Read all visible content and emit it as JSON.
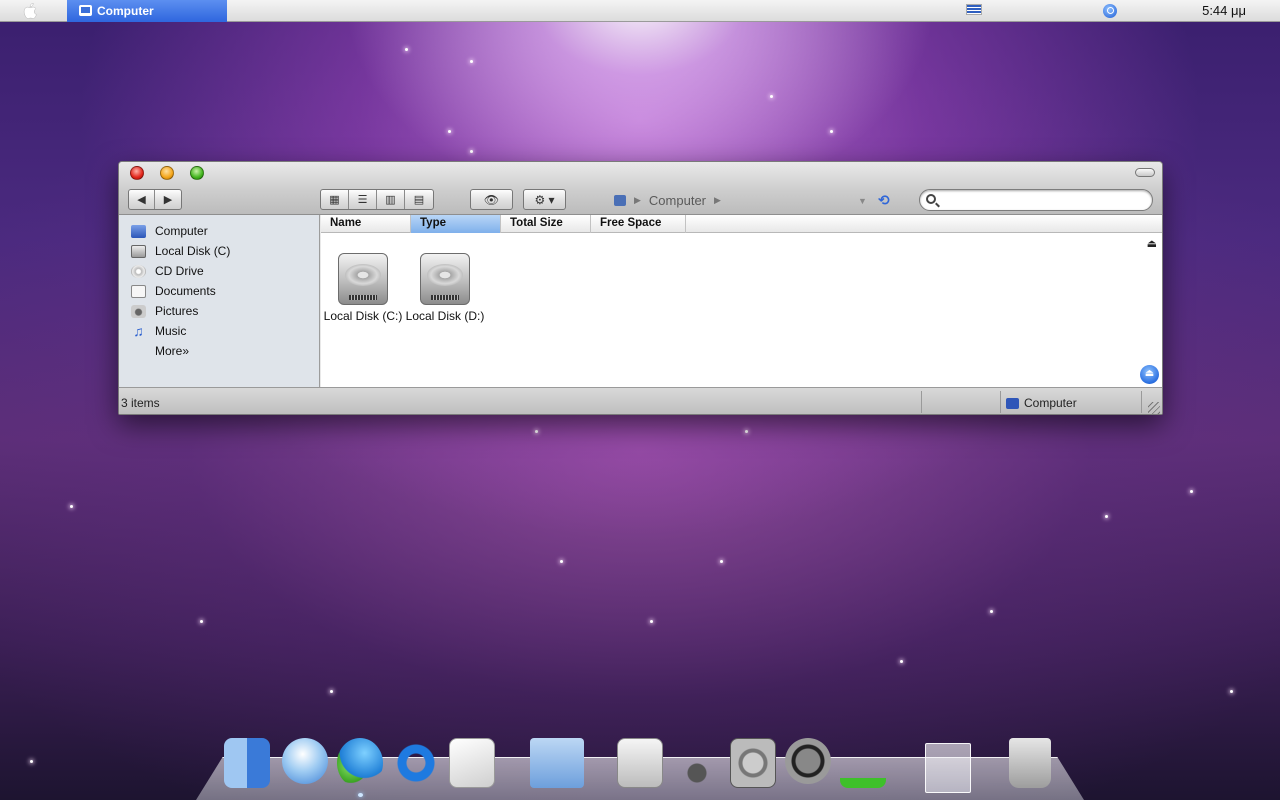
{
  "menubar": {
    "app_name": "Computer",
    "clock": "5:44 μμ",
    "icons": [
      "apple-icon",
      "computer-icon",
      "flag-icon",
      "spotlight-icon"
    ]
  },
  "window": {
    "path": {
      "current": "Computer"
    },
    "search": {
      "value": "",
      "placeholder": ""
    },
    "sidebar": {
      "items": [
        {
          "label": "Computer",
          "icon": "computer-icon"
        },
        {
          "label": "Local Disk (C)",
          "icon": "hard-disk-icon"
        },
        {
          "label": "CD Drive",
          "icon": "cd-drive-icon"
        },
        {
          "label": "Documents",
          "icon": "documents-icon"
        },
        {
          "label": "Pictures",
          "icon": "pictures-icon"
        },
        {
          "label": "Music",
          "icon": "music-icon"
        }
      ],
      "more": "More»"
    },
    "columns": [
      "Name",
      "Type",
      "Total Size",
      "Free Space"
    ],
    "active_column": "Type",
    "items": [
      {
        "label": "Local Disk (C:)",
        "icon": "hard-disk-icon"
      },
      {
        "label": "Local Disk (D:)",
        "icon": "hard-disk-icon"
      }
    ],
    "status": {
      "count": "3 items",
      "location": "Computer"
    }
  },
  "dock": {
    "items": [
      "finder-icon",
      "itunes-icon",
      "messenger-icon",
      "internet-explorer-icon",
      "textedit-icon",
      "applications-folder-icon",
      "scissors-icon",
      "system-profiler-icon",
      "system-preferences-icon",
      "shutdown-icon",
      "activity-monitor-icon",
      "stack-icon",
      "trash-icon"
    ]
  },
  "colors": {
    "menubar_accent": "#2f66de",
    "sidebar_bg": "#dfe4ea",
    "active_column": "#7fb0eb"
  }
}
